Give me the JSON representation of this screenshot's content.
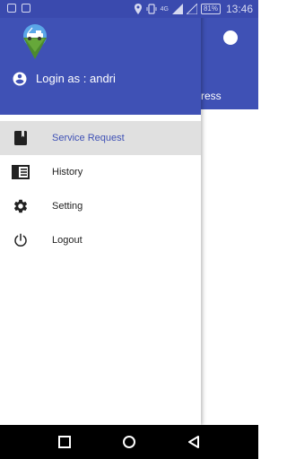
{
  "status_bar": {
    "network_label": "4G",
    "battery": "81%",
    "time": "13:46"
  },
  "drawer": {
    "login_text": "Login as : andri",
    "menu": [
      {
        "label": "Service Request",
        "icon": "book-icon",
        "active": true
      },
      {
        "label": "History",
        "icon": "history-list-icon",
        "active": false
      },
      {
        "label": "Setting",
        "icon": "gear-icon",
        "active": false
      },
      {
        "label": "Logout",
        "icon": "power-icon",
        "active": false
      }
    ]
  },
  "background_screen": {
    "tab_text": "ress"
  },
  "colors": {
    "primary": "#3f51b5",
    "status_bar": "#3a4aae",
    "active_item_bg": "#e0e0e0"
  }
}
